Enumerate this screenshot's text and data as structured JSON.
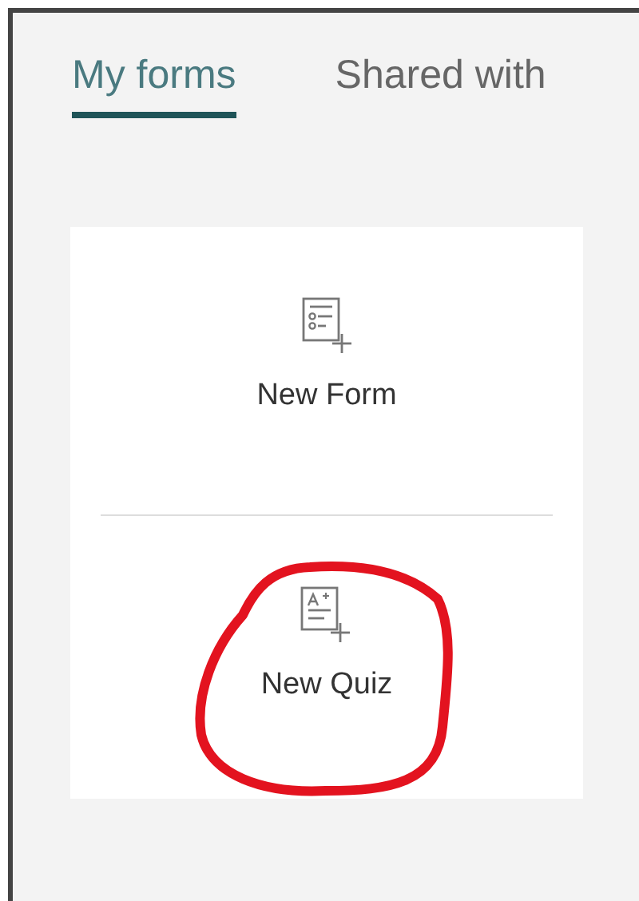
{
  "tabs": [
    {
      "label": "My forms",
      "selected": true
    },
    {
      "label": "Shared with",
      "selected": false
    }
  ],
  "new_items": [
    {
      "kind": "form",
      "label": "New Form",
      "circled": false
    },
    {
      "kind": "quiz",
      "label": "New Quiz",
      "circled": true
    }
  ]
}
